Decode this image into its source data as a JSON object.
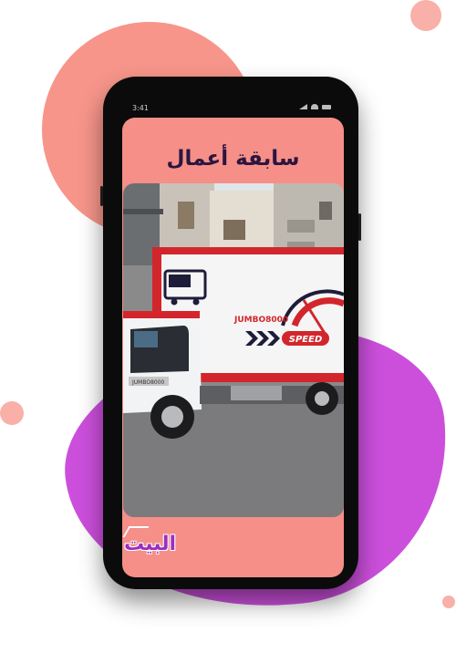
{
  "screen": {
    "title": "سابقة أعمال",
    "status_time": "3:41"
  },
  "truck": {
    "brand_text": "JUMBO8000",
    "speed_text": "SPEED",
    "grille_text": "JUMBO8000"
  },
  "logo": {
    "text": "البيت"
  },
  "colors": {
    "coral": "#f58f88",
    "purple": "#cc4fdc",
    "title": "#2b1540",
    "truck_red": "#d2262c"
  }
}
